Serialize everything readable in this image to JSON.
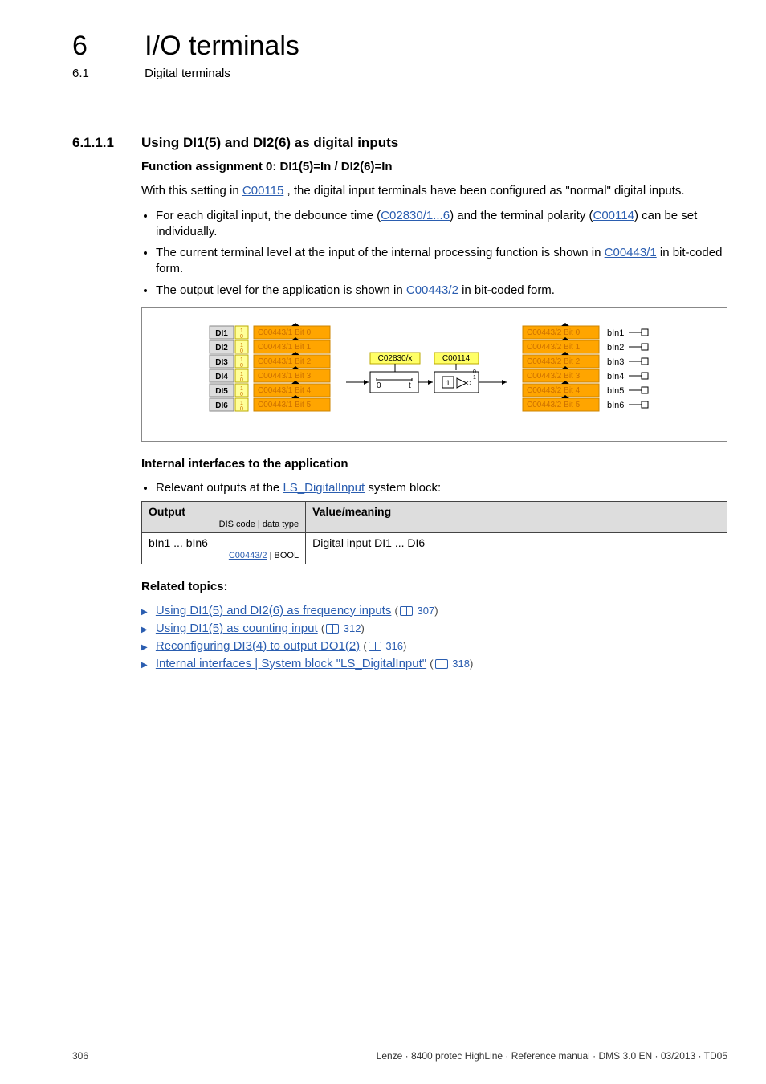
{
  "header": {
    "chapter_num": "6",
    "chapter_title": "I/O terminals",
    "sub_num": "6.1",
    "sub_title": "Digital terminals"
  },
  "section": {
    "num": "6.1.1.1",
    "title": "Using DI1(5) and DI2(6) as digital inputs"
  },
  "fa_heading": "Function assignment 0: DI1(5)=In / DI2(6)=In",
  "intro": {
    "pre": "With this setting in ",
    "link": "C00115",
    "post": " , the digital input terminals have been configured as \"normal\" digital inputs."
  },
  "bullets_main": {
    "b1": {
      "t1": "For each digital input, the debounce time (",
      "l1": "C02830/1...6",
      "t2": ") and the terminal polarity (",
      "l2": "C00114",
      "t3": ") can be set individually."
    },
    "b2": {
      "t1": "The current terminal level at the input of the internal processing function is shown in ",
      "l1": "C00443/1",
      "t2": " in bit-coded form."
    },
    "b3": {
      "t1": "The output level for the application is shown in ",
      "l1": "C00443/2",
      "t2": " in bit-coded form."
    }
  },
  "diagram": {
    "di": [
      "DI1",
      "DI2",
      "DI3",
      "DI4",
      "DI5",
      "DI6"
    ],
    "left_bits": [
      "C00443/1 Bit 0",
      "C00443/1 Bit 1",
      "C00443/1 Bit 2",
      "C00443/1 Bit 3",
      "C00443/1 Bit 4",
      "C00443/1 Bit 5"
    ],
    "right_bits": [
      "C00443/2 Bit 0",
      "C00443/2 Bit 1",
      "C00443/2 Bit 2",
      "C00443/2 Bit 3",
      "C00443/2 Bit 4",
      "C00443/2 Bit 5"
    ],
    "outs": [
      "bIn1",
      "bIn2",
      "bIn3",
      "bIn4",
      "bIn5",
      "bIn6"
    ],
    "param1": "C02830/x",
    "param2": "C00114",
    "zero": "0",
    "one": "1",
    "t": "t"
  },
  "internal_heading": "Internal interfaces to the application",
  "internal_line": {
    "pre": "Relevant outputs at the ",
    "link": "LS_DigitalInput",
    "post": " system block:"
  },
  "table": {
    "h1": "Output",
    "h1sub": "DIS code | data type",
    "h2": "Value/meaning",
    "r1c1": "bIn1 ... bIn6",
    "r1c1sub_l": "C00443/2",
    "r1c1sub_r": " | BOOL",
    "r1c2": "Digital input DI1 ... DI6"
  },
  "related_heading": "Related topics:",
  "related": {
    "i1": {
      "text": "Using DI1(5) and DI2(6) as frequency inputs",
      "page": "307"
    },
    "i2": {
      "text": "Using DI1(5) as counting input",
      "page": "312"
    },
    "i3": {
      "text": "Reconfiguring DI3(4) to output DO1(2)",
      "page": "316"
    },
    "i4": {
      "text": "Internal interfaces | System block \"LS_DigitalInput\"",
      "page": "318"
    }
  },
  "footer": {
    "page": "306",
    "right": "Lenze · 8400 protec HighLine · Reference manual · DMS 3.0 EN · 03/2013 · TD05"
  }
}
